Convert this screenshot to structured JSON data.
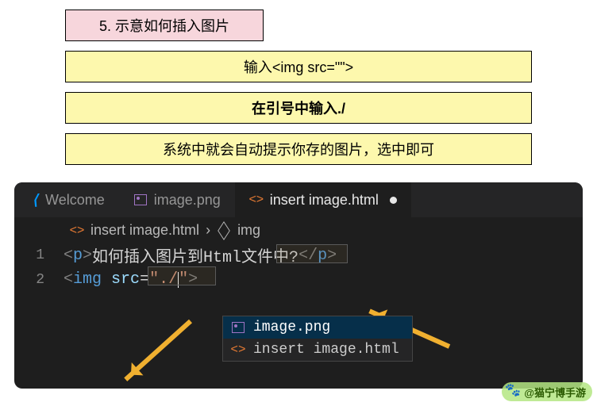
{
  "header": {
    "title": "5. 示意如何插入图片"
  },
  "steps": [
    "输入<img src=\"\">",
    "在引号中输入./",
    "系统中就会自动提示你存的图片，选中即可"
  ],
  "editor": {
    "tabs": {
      "welcome": "Welcome",
      "image": "image.png",
      "active": "insert image.html"
    },
    "breadcrumb": {
      "file": "insert image.html",
      "el": "img"
    },
    "line1": {
      "num": "1",
      "open": "<",
      "tag": "p",
      "gt": ">",
      "text": "如何插入图片到Html文件中?",
      "close": "</",
      "closeGt": ">"
    },
    "line2": {
      "num": "2",
      "open": "<",
      "tag": "img",
      "attr": "src",
      "eq": "=",
      "val1": "\"./",
      "val2": "\"",
      "gt": ">"
    },
    "suggest": {
      "img": "image.png",
      "html": "insert image.html"
    }
  },
  "watermark": "@猫宁博手游"
}
